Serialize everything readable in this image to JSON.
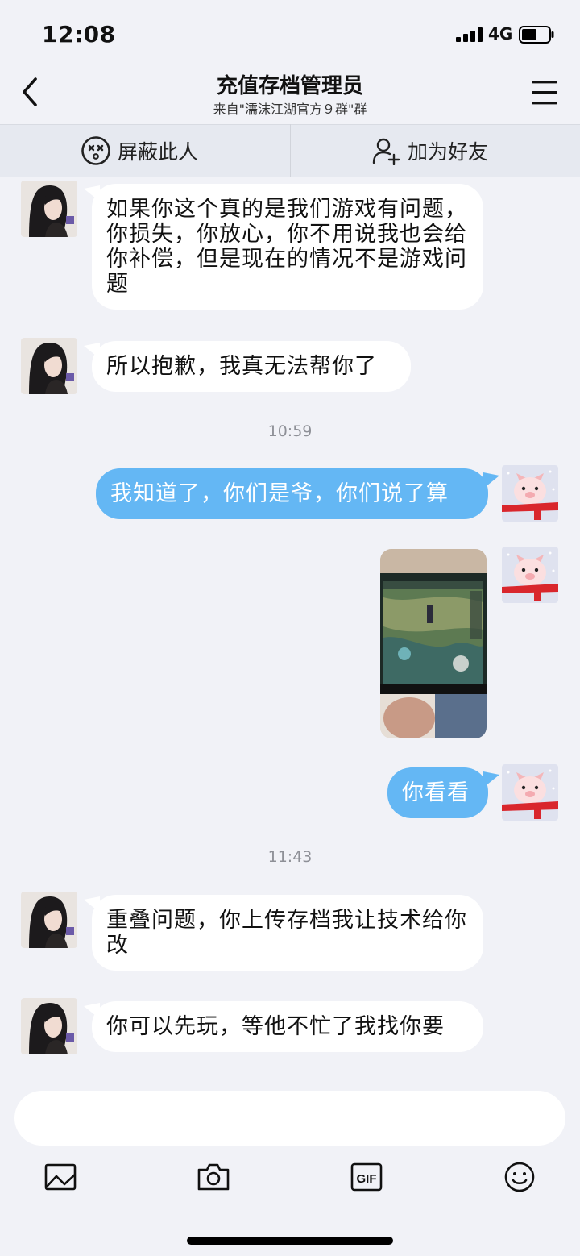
{
  "status_bar": {
    "time": "12:08",
    "network": "4G"
  },
  "header": {
    "title": "充值存档管理员",
    "subtitle": "来自\"濡沫江湖官方９群\"群"
  },
  "actions": {
    "block_label": "屏蔽此人",
    "add_friend_label": "加为好友"
  },
  "messages": {
    "m1": "如果你这个真的是我们游戏有问题，你损失，你放心，你不用说我也会给你补偿，但是现在的情况不是游戏问题",
    "m2": "所以抱歉，我真无法帮你了",
    "t1": "10:59",
    "m3": "我知道了，你们是爷，你们说了算",
    "m5": "你看看",
    "t2": "11:43",
    "m6": "重叠问题，你上传存档我让技术给你改",
    "m7": "你可以先玩，等他不忙了我找你要"
  },
  "input": {
    "placeholder": ""
  },
  "toolbar": {
    "gif_label": "GIF"
  },
  "colors": {
    "outgoing_bubble": "#64b7f4",
    "background": "#f1f2f7"
  },
  "icons": [
    "back-arrow-icon",
    "menu-icon",
    "block-icon",
    "add-friend-icon",
    "image-icon",
    "camera-icon",
    "gif-icon",
    "emoji-icon"
  ]
}
